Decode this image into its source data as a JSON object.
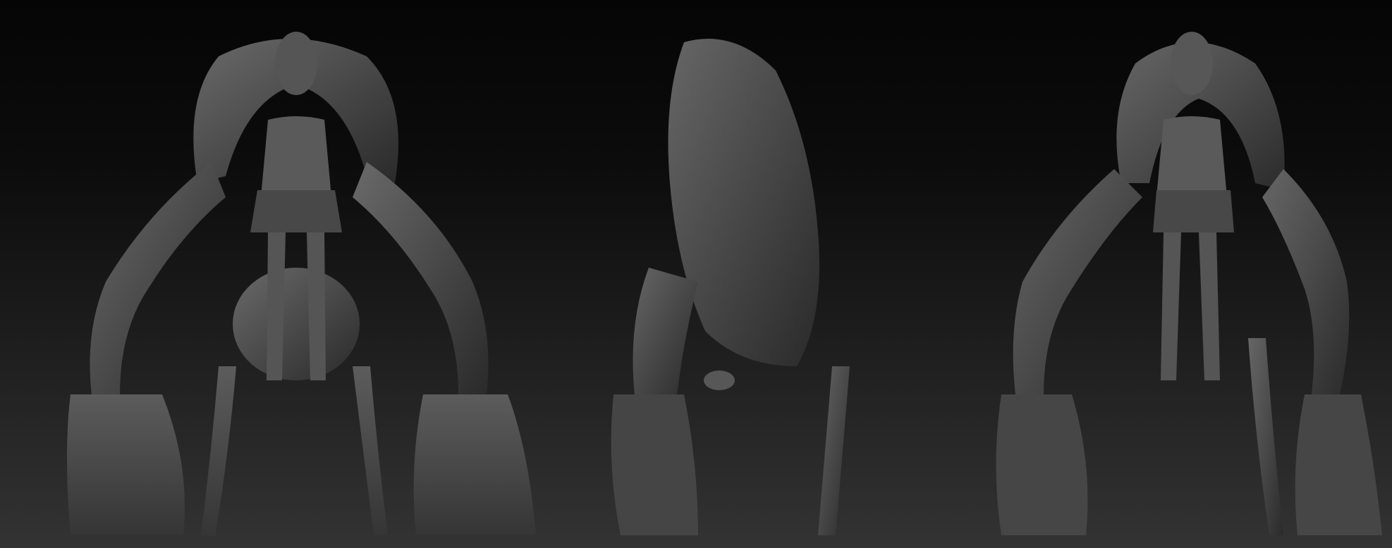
{
  "scene": {
    "background_top": "#050505",
    "background_bottom": "#333333",
    "clay_color": "#4a4a4a",
    "clay_highlight": "#6a6a6a",
    "clay_shadow": "#2a2a2a"
  },
  "views": [
    {
      "id": "front"
    },
    {
      "id": "side"
    },
    {
      "id": "three-quarter"
    }
  ]
}
